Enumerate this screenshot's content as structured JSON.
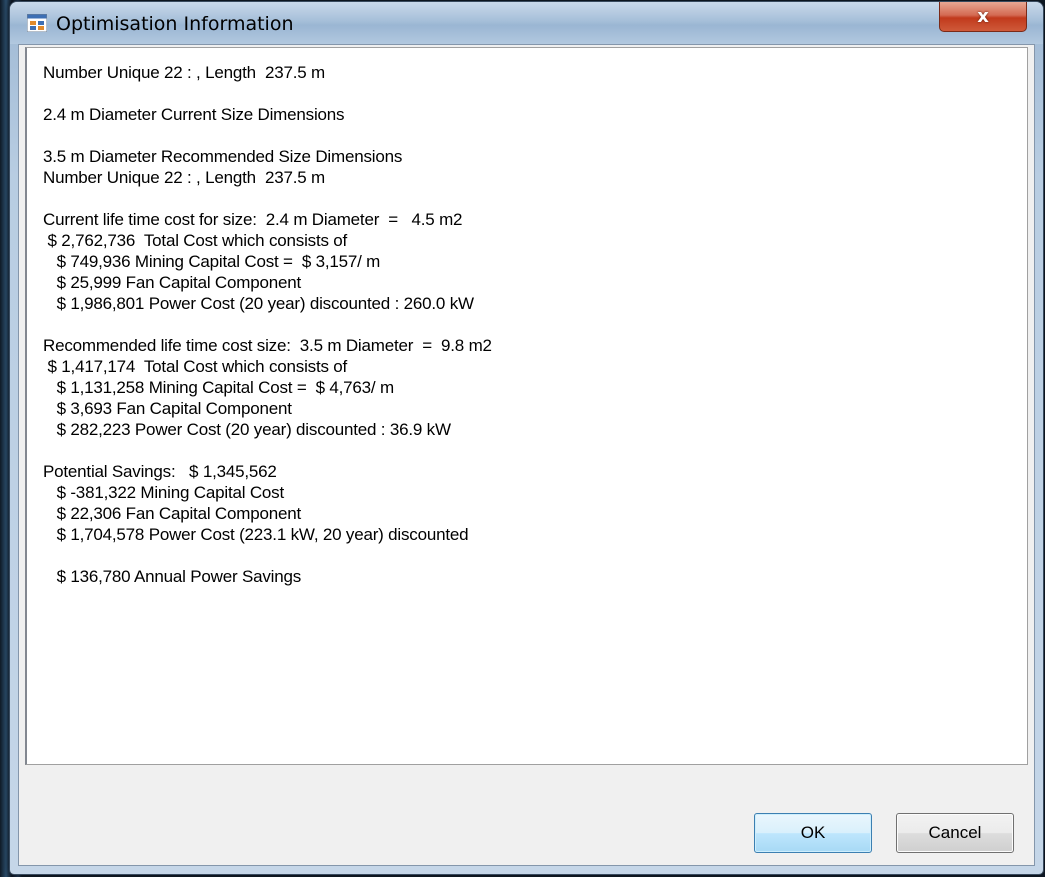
{
  "window": {
    "title": "Optimisation Information",
    "icon": "application-icon",
    "close_label": "x"
  },
  "info": {
    "text": "Number Unique 22 : , Length  237.5 m\n\n2.4 m Diameter Current Size Dimensions\n\n3.5 m Diameter Recommended Size Dimensions\nNumber Unique 22 : , Length  237.5 m\n\nCurrent life time cost for size:  2.4 m Diameter  =   4.5 m2\n $ 2,762,736  Total Cost which consists of\n   $ 749,936 Mining Capital Cost =  $ 3,157/ m\n   $ 25,999 Fan Capital Component\n   $ 1,986,801 Power Cost (20 year) discounted : 260.0 kW\n\nRecommended life time cost size:  3.5 m Diameter  =  9.8 m2\n $ 1,417,174  Total Cost which consists of\n   $ 1,131,258 Mining Capital Cost =  $ 4,763/ m\n   $ 3,693 Fan Capital Component\n   $ 282,223 Power Cost (20 year) discounted : 36.9 kW\n\nPotential Savings:   $ 1,345,562\n   $ -381,322 Mining Capital Cost\n   $ 22,306 Fan Capital Component\n   $ 1,704,578 Power Cost (223.1 kW, 20 year) discounted\n\n   $ 136,780 Annual Power Savings"
  },
  "buttons": {
    "ok_label": "OK",
    "cancel_label": "Cancel"
  },
  "colors": {
    "titlebar": "#a6bfd9",
    "close_button": "#c13a1c",
    "dialog_background": "#f0f0f0",
    "text_background": "#ffffff",
    "ok_button_border": "#3c7fb1"
  }
}
